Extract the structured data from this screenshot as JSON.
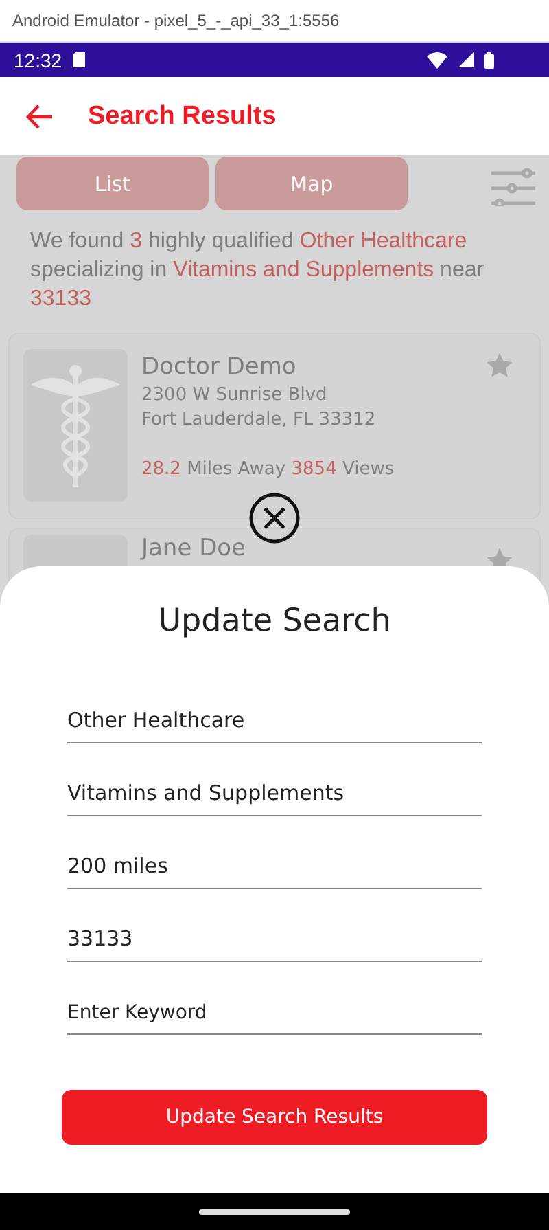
{
  "window": {
    "title": "Android Emulator - pixel_5_-_api_33_1:5556"
  },
  "status_bar": {
    "time": "12:32"
  },
  "app_bar": {
    "title": "Search Results"
  },
  "view_tabs": [
    {
      "label": "List",
      "selected": false
    },
    {
      "label": "Map",
      "selected": false
    }
  ],
  "summary": [
    {
      "text": "We found ",
      "highlight": false
    },
    {
      "text": "3",
      "highlight": true
    },
    {
      "text": " highly qualified ",
      "highlight": false
    },
    {
      "text": "Other Healthcare",
      "highlight": true
    },
    {
      "text": " specializing in ",
      "highlight": false
    },
    {
      "text": "Vitamins and Supplements",
      "highlight": true
    },
    {
      "text": " near ",
      "highlight": false
    },
    {
      "text": "33133",
      "highlight": true
    }
  ],
  "results": [
    {
      "name": "Doctor  Demo",
      "address": "2300 W Sunrise Blvd",
      "city": "Fort Lauderdale, FL   33312",
      "distance": "28.2",
      "distance_label": "Miles Away",
      "views": "3854",
      "views_label": "Views"
    },
    {
      "name": "Jane  Doe"
    }
  ],
  "sheet": {
    "title": "Update Search",
    "fields": [
      {
        "value": "Other Healthcare"
      },
      {
        "value": "Vitamins and Supplements"
      },
      {
        "value": "200 miles"
      },
      {
        "value": "33133"
      },
      {
        "placeholder": "Enter Keyword"
      }
    ],
    "button": "Update Search Results"
  }
}
